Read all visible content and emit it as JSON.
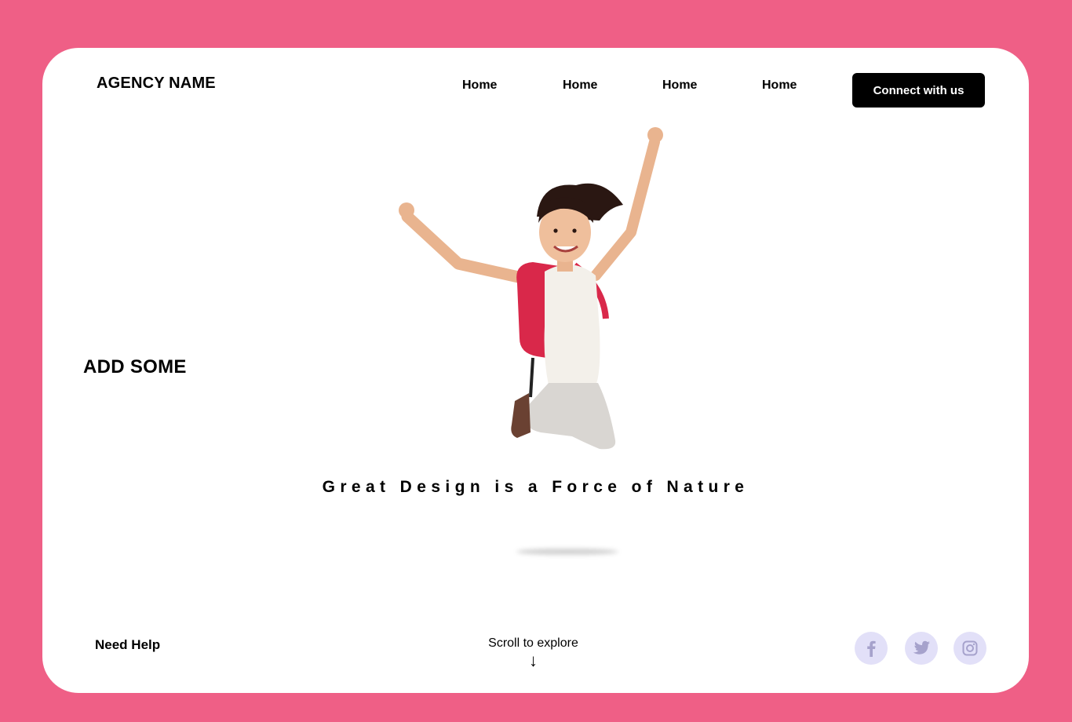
{
  "header": {
    "brand": "AGENCY NAME",
    "nav": [
      {
        "label": "Home"
      },
      {
        "label": "Home"
      },
      {
        "label": "Home"
      },
      {
        "label": "Home"
      }
    ],
    "cta_label": "Connect with us"
  },
  "hero": {
    "side_text": "ADD SOME",
    "tagline": "Great Design is a Force of Nature"
  },
  "footer": {
    "help_label": "Need Help",
    "scroll_label": "Scroll to explore",
    "scroll_arrow": "↓",
    "social": [
      {
        "icon": "facebook-icon"
      },
      {
        "icon": "twitter-icon"
      },
      {
        "icon": "instagram-icon"
      }
    ]
  },
  "colors": {
    "background": "#ef5f86",
    "card": "#ffffff",
    "cta": "#000000",
    "social_bg": "#e2e0f8",
    "social_icon": "#a6a2cc",
    "backpack": "#d9284a"
  }
}
